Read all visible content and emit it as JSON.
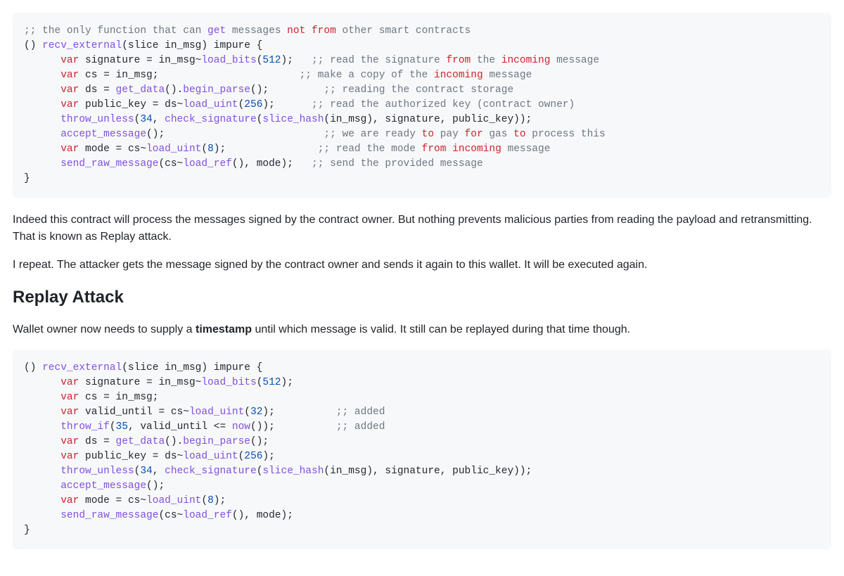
{
  "code1": {
    "lines": [
      [
        {
          "t": ";; the only function that can ",
          "c": "tk-cm"
        },
        {
          "t": "get",
          "c": "tk-cm-fn"
        },
        {
          "t": " messages ",
          "c": "tk-cm"
        },
        {
          "t": "not",
          "c": "tk-cm-kw"
        },
        {
          "t": " ",
          "c": "tk-cm"
        },
        {
          "t": "from",
          "c": "tk-cm-kw"
        },
        {
          "t": " other smart contracts",
          "c": "tk-cm"
        }
      ],
      [
        {
          "t": "() ",
          "c": "tk-id"
        },
        {
          "t": "recv_external",
          "c": "tk-fn"
        },
        {
          "t": "(slice in_msg) impure {",
          "c": "tk-id"
        }
      ],
      [
        {
          "t": "      ",
          "c": ""
        },
        {
          "t": "var",
          "c": "tk-kw"
        },
        {
          "t": " signature = in_msg~",
          "c": "tk-id"
        },
        {
          "t": "load_bits",
          "c": "tk-fn"
        },
        {
          "t": "(",
          "c": "tk-id"
        },
        {
          "t": "512",
          "c": "tk-num"
        },
        {
          "t": ");   ",
          "c": "tk-id"
        },
        {
          "t": ";; read the signature ",
          "c": "tk-cm"
        },
        {
          "t": "from",
          "c": "tk-cm-kw"
        },
        {
          "t": " the ",
          "c": "tk-cm"
        },
        {
          "t": "incoming",
          "c": "tk-cm-kw"
        },
        {
          "t": " message",
          "c": "tk-cm"
        }
      ],
      [
        {
          "t": "      ",
          "c": ""
        },
        {
          "t": "var",
          "c": "tk-kw"
        },
        {
          "t": " cs = in_msg;                       ",
          "c": "tk-id"
        },
        {
          "t": ";; make a copy of the ",
          "c": "tk-cm"
        },
        {
          "t": "incoming",
          "c": "tk-cm-kw"
        },
        {
          "t": " message",
          "c": "tk-cm"
        }
      ],
      [
        {
          "t": "      ",
          "c": ""
        },
        {
          "t": "var",
          "c": "tk-kw"
        },
        {
          "t": " ds = ",
          "c": "tk-id"
        },
        {
          "t": "get_data",
          "c": "tk-fn"
        },
        {
          "t": "().",
          "c": "tk-id"
        },
        {
          "t": "begin_parse",
          "c": "tk-fn"
        },
        {
          "t": "();         ",
          "c": "tk-id"
        },
        {
          "t": ";; reading the contract storage",
          "c": "tk-cm"
        }
      ],
      [
        {
          "t": "      ",
          "c": ""
        },
        {
          "t": "var",
          "c": "tk-kw"
        },
        {
          "t": " public_key = ds~",
          "c": "tk-id"
        },
        {
          "t": "load_uint",
          "c": "tk-fn"
        },
        {
          "t": "(",
          "c": "tk-id"
        },
        {
          "t": "256",
          "c": "tk-num"
        },
        {
          "t": ");      ",
          "c": "tk-id"
        },
        {
          "t": ";; read the authorized key (contract owner)",
          "c": "tk-cm"
        }
      ],
      [
        {
          "t": "      ",
          "c": ""
        },
        {
          "t": "throw_unless",
          "c": "tk-fn"
        },
        {
          "t": "(",
          "c": "tk-id"
        },
        {
          "t": "34",
          "c": "tk-num"
        },
        {
          "t": ", ",
          "c": "tk-id"
        },
        {
          "t": "check_signature",
          "c": "tk-fn"
        },
        {
          "t": "(",
          "c": "tk-id"
        },
        {
          "t": "slice_hash",
          "c": "tk-fn"
        },
        {
          "t": "(in_msg), signature, public_key));",
          "c": "tk-id"
        }
      ],
      [
        {
          "t": "      ",
          "c": ""
        },
        {
          "t": "accept_message",
          "c": "tk-fn"
        },
        {
          "t": "();                          ",
          "c": "tk-id"
        },
        {
          "t": ";; we are ready ",
          "c": "tk-cm"
        },
        {
          "t": "to",
          "c": "tk-cm-to"
        },
        {
          "t": " pay ",
          "c": "tk-cm"
        },
        {
          "t": "for",
          "c": "tk-cm-kw"
        },
        {
          "t": " gas ",
          "c": "tk-cm"
        },
        {
          "t": "to",
          "c": "tk-cm-to"
        },
        {
          "t": " process this",
          "c": "tk-cm"
        }
      ],
      [
        {
          "t": "      ",
          "c": ""
        },
        {
          "t": "var",
          "c": "tk-kw"
        },
        {
          "t": " mode = cs~",
          "c": "tk-id"
        },
        {
          "t": "load_uint",
          "c": "tk-fn"
        },
        {
          "t": "(",
          "c": "tk-id"
        },
        {
          "t": "8",
          "c": "tk-num"
        },
        {
          "t": ");               ",
          "c": "tk-id"
        },
        {
          "t": ";; read the mode ",
          "c": "tk-cm"
        },
        {
          "t": "from",
          "c": "tk-cm-kw"
        },
        {
          "t": " ",
          "c": "tk-cm"
        },
        {
          "t": "incoming",
          "c": "tk-cm-kw"
        },
        {
          "t": " message",
          "c": "tk-cm"
        }
      ],
      [
        {
          "t": "      ",
          "c": ""
        },
        {
          "t": "send_raw_message",
          "c": "tk-fn"
        },
        {
          "t": "(cs~",
          "c": "tk-id"
        },
        {
          "t": "load_ref",
          "c": "tk-fn"
        },
        {
          "t": "(), mode);   ",
          "c": "tk-id"
        },
        {
          "t": ";; send the provided message",
          "c": "tk-cm"
        }
      ],
      [
        {
          "t": "}",
          "c": "tk-id"
        }
      ]
    ]
  },
  "p1": "Indeed this contract will process the messages signed by the contract owner. But nothing prevents malicious parties from reading the payload and retransmitting. That is known as Replay attack.",
  "p2": "I repeat. The attacker gets the message signed by the contract owner and sends it again to this wallet. It will be executed again.",
  "h2": "Replay Attack",
  "p3_a": "Wallet owner now needs to supply a ",
  "p3_b": "timestamp",
  "p3_c": " until which message is valid. It still can be replayed during that time though.",
  "code2": {
    "lines": [
      [
        {
          "t": "() ",
          "c": "tk-id"
        },
        {
          "t": "recv_external",
          "c": "tk-fn"
        },
        {
          "t": "(slice in_msg) impure {",
          "c": "tk-id"
        }
      ],
      [
        {
          "t": "      ",
          "c": ""
        },
        {
          "t": "var",
          "c": "tk-kw"
        },
        {
          "t": " signature = in_msg~",
          "c": "tk-id"
        },
        {
          "t": "load_bits",
          "c": "tk-fn"
        },
        {
          "t": "(",
          "c": "tk-id"
        },
        {
          "t": "512",
          "c": "tk-num"
        },
        {
          "t": ");",
          "c": "tk-id"
        }
      ],
      [
        {
          "t": "      ",
          "c": ""
        },
        {
          "t": "var",
          "c": "tk-kw"
        },
        {
          "t": " cs = in_msg;",
          "c": "tk-id"
        }
      ],
      [
        {
          "t": "      ",
          "c": ""
        },
        {
          "t": "var",
          "c": "tk-kw"
        },
        {
          "t": " valid_until = cs~",
          "c": "tk-id"
        },
        {
          "t": "load_uint",
          "c": "tk-fn"
        },
        {
          "t": "(",
          "c": "tk-id"
        },
        {
          "t": "32",
          "c": "tk-num"
        },
        {
          "t": ");          ",
          "c": "tk-id"
        },
        {
          "t": ";; added",
          "c": "tk-cm"
        }
      ],
      [
        {
          "t": "      ",
          "c": ""
        },
        {
          "t": "throw_if",
          "c": "tk-fn"
        },
        {
          "t": "(",
          "c": "tk-id"
        },
        {
          "t": "35",
          "c": "tk-num"
        },
        {
          "t": ", valid_until <= ",
          "c": "tk-id"
        },
        {
          "t": "now",
          "c": "tk-fn"
        },
        {
          "t": "());          ",
          "c": "tk-id"
        },
        {
          "t": ";; added",
          "c": "tk-cm"
        }
      ],
      [
        {
          "t": "      ",
          "c": ""
        },
        {
          "t": "var",
          "c": "tk-kw"
        },
        {
          "t": " ds = ",
          "c": "tk-id"
        },
        {
          "t": "get_data",
          "c": "tk-fn"
        },
        {
          "t": "().",
          "c": "tk-id"
        },
        {
          "t": "begin_parse",
          "c": "tk-fn"
        },
        {
          "t": "();",
          "c": "tk-id"
        }
      ],
      [
        {
          "t": "      ",
          "c": ""
        },
        {
          "t": "var",
          "c": "tk-kw"
        },
        {
          "t": " public_key = ds~",
          "c": "tk-id"
        },
        {
          "t": "load_uint",
          "c": "tk-fn"
        },
        {
          "t": "(",
          "c": "tk-id"
        },
        {
          "t": "256",
          "c": "tk-num"
        },
        {
          "t": ");",
          "c": "tk-id"
        }
      ],
      [
        {
          "t": "      ",
          "c": ""
        },
        {
          "t": "throw_unless",
          "c": "tk-fn"
        },
        {
          "t": "(",
          "c": "tk-id"
        },
        {
          "t": "34",
          "c": "tk-num"
        },
        {
          "t": ", ",
          "c": "tk-id"
        },
        {
          "t": "check_signature",
          "c": "tk-fn"
        },
        {
          "t": "(",
          "c": "tk-id"
        },
        {
          "t": "slice_hash",
          "c": "tk-fn"
        },
        {
          "t": "(in_msg), signature, public_key));",
          "c": "tk-id"
        }
      ],
      [
        {
          "t": "      ",
          "c": ""
        },
        {
          "t": "accept_message",
          "c": "tk-fn"
        },
        {
          "t": "();",
          "c": "tk-id"
        }
      ],
      [
        {
          "t": "      ",
          "c": ""
        },
        {
          "t": "var",
          "c": "tk-kw"
        },
        {
          "t": " mode = cs~",
          "c": "tk-id"
        },
        {
          "t": "load_uint",
          "c": "tk-fn"
        },
        {
          "t": "(",
          "c": "tk-id"
        },
        {
          "t": "8",
          "c": "tk-num"
        },
        {
          "t": ");",
          "c": "tk-id"
        }
      ],
      [
        {
          "t": "      ",
          "c": ""
        },
        {
          "t": "send_raw_message",
          "c": "tk-fn"
        },
        {
          "t": "(cs~",
          "c": "tk-id"
        },
        {
          "t": "load_ref",
          "c": "tk-fn"
        },
        {
          "t": "(), mode);",
          "c": "tk-id"
        }
      ],
      [
        {
          "t": "}",
          "c": "tk-id"
        }
      ]
    ]
  }
}
